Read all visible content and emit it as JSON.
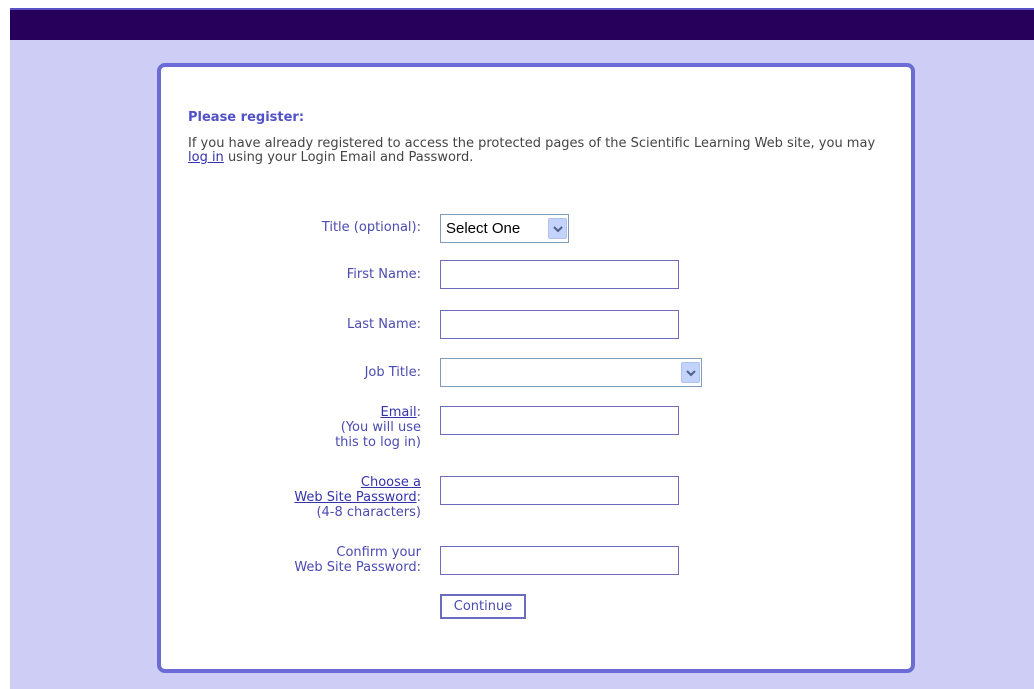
{
  "form": {
    "heading": "Please register:",
    "intro_before": "If you have already registered to access the protected pages of the Scientific Learning Web site, you may ",
    "intro_link": "log in",
    "intro_after": " using your Login Email and Password.",
    "title_label": "Title (optional):",
    "title_value": "Select One",
    "first_name_label": "First Name:",
    "first_name_value": "",
    "last_name_label": "Last Name:",
    "last_name_value": "",
    "job_title_label": "Job Title:",
    "job_title_value": "",
    "email_link": "Email",
    "email_colon": ":",
    "email_hint_1": "(You will use",
    "email_hint_2": "this to log in)",
    "email_value": "",
    "password_link_1": "Choose a",
    "password_link_2": "Web Site Password",
    "password_colon": ":",
    "password_hint": "(4-8 characters)",
    "password_value": "",
    "confirm_label_1": "Confirm your",
    "confirm_label_2": "Web Site Password:",
    "confirm_value": "",
    "continue_label": "Continue"
  },
  "colors": {
    "page_background": "#cdcdf5",
    "top_bar": "#26005a",
    "card_border": "#6b6bd6",
    "label_text": "#4b4bb0",
    "heading_text": "#5151c8"
  },
  "icons": {
    "dropdown": "chevron-down-icon"
  }
}
